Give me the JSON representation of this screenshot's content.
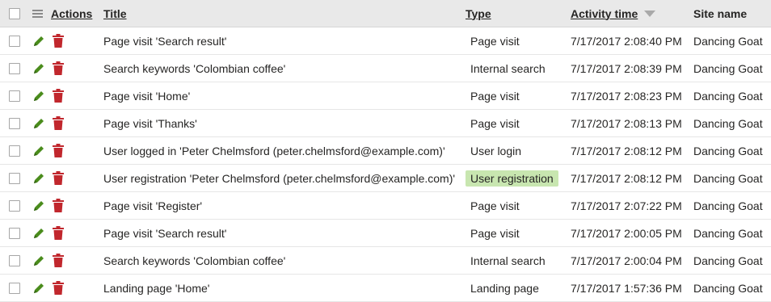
{
  "header": {
    "actions": "Actions",
    "title": "Title",
    "type": "Type",
    "activity_time": "Activity time",
    "site_name": "Site name"
  },
  "icons": {
    "edit": "pencil-icon",
    "delete": "trash-icon",
    "menu": "hamburger-icon",
    "sort": "sort-descending-icon"
  },
  "colors": {
    "edit": "#4a8c1c",
    "delete": "#c1272d",
    "highlight": "#c8e6b0",
    "header_bg": "#e9e9e9"
  },
  "rows": [
    {
      "title": "Page visit 'Search result'",
      "type": "Page visit",
      "time": "7/17/2017 2:08:40 PM",
      "site": "Dancing Goat"
    },
    {
      "title": "Search keywords 'Colombian coffee'",
      "type": "Internal search",
      "time": "7/17/2017 2:08:39 PM",
      "site": "Dancing Goat"
    },
    {
      "title": "Page visit 'Home'",
      "type": "Page visit",
      "time": "7/17/2017 2:08:23 PM",
      "site": "Dancing Goat"
    },
    {
      "title": "Page visit 'Thanks'",
      "type": "Page visit",
      "time": "7/17/2017 2:08:13 PM",
      "site": "Dancing Goat"
    },
    {
      "title": "User logged in 'Peter Chelmsford (peter.chelmsford@example.com)'",
      "type": "User login",
      "time": "7/17/2017 2:08:12 PM",
      "site": "Dancing Goat"
    },
    {
      "title": "User registration 'Peter Chelmsford (peter.chelmsford@example.com)'",
      "type": "User registration",
      "time": "7/17/2017 2:08:12 PM",
      "site": "Dancing Goat"
    },
    {
      "title": "Page visit 'Register'",
      "type": "Page visit",
      "time": "7/17/2017 2:07:22 PM",
      "site": "Dancing Goat"
    },
    {
      "title": "Page visit 'Search result'",
      "type": "Page visit",
      "time": "7/17/2017 2:00:05 PM",
      "site": "Dancing Goat"
    },
    {
      "title": "Search keywords 'Colombian coffee'",
      "type": "Internal search",
      "time": "7/17/2017 2:00:04 PM",
      "site": "Dancing Goat"
    },
    {
      "title": "Landing page 'Home'",
      "type": "Landing page",
      "time": "7/17/2017 1:57:36 PM",
      "site": "Dancing Goat"
    }
  ]
}
